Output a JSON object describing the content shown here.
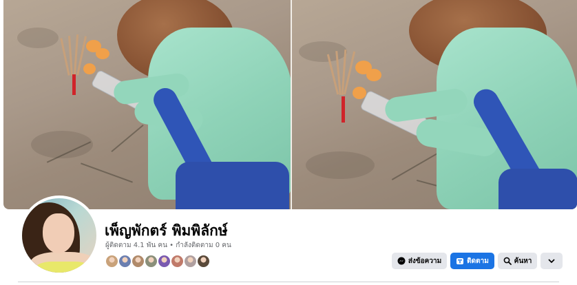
{
  "profile": {
    "name": "เพ็ญพักตร์ พิมพิลักษ์",
    "stats": "ผู้ติดตาม 4.1 พัน คน • กำลังติดตาม 0 คน"
  },
  "actions": {
    "message_label": "ส่งข้อความ",
    "follow_label": "ติดตาม",
    "search_label": "ค้นหา"
  },
  "icons": {
    "message": "messenger-icon",
    "follow": "follow-icon",
    "search": "search-icon",
    "more": "chevron-down-icon"
  },
  "colors": {
    "primary": "#1b74e4",
    "button_grey": "#e4e6eb",
    "secondary_text": "#65676b",
    "strap_blue": "#2f55b7",
    "shirt_mint": "#93d6bb"
  },
  "follower_avatars": [
    "#c9a27a",
    "#6b7fb0",
    "#b08a6a",
    "#8a8f7a",
    "#7a5ab0",
    "#c07a6a",
    "#b0a0a0",
    "#5a4a3a"
  ]
}
